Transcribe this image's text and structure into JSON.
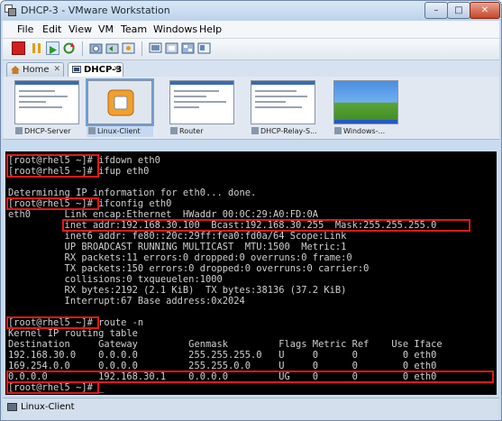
{
  "window": {
    "title": "DHCP-3 - VMware Workstation"
  },
  "menu": [
    "File",
    "Edit",
    "View",
    "VM",
    "Team",
    "Windows",
    "Help"
  ],
  "tabs": [
    {
      "label": "Home",
      "active": false
    },
    {
      "label": "DHCP-3",
      "active": true
    }
  ],
  "thumbnails": [
    {
      "label": "DHCP-Server",
      "selected": false
    },
    {
      "label": "Linux-Client",
      "selected": true
    },
    {
      "label": "Router",
      "selected": false
    },
    {
      "label": "DHCP-Relay-S...",
      "selected": false
    },
    {
      "label": "Windows-...",
      "selected": false
    }
  ],
  "console_lines": [
    "[root@rhel5 ~]# ifdown eth0",
    "[root@rhel5 ~]# ifup eth0",
    "",
    "Determining IP information for eth0... done.",
    "[root@rhel5 ~]# ifconfig eth0",
    "eth0      Link encap:Ethernet  HWaddr 00:0C:29:A0:FD:0A",
    "          inet addr:192.168.30.100  Bcast:192.168.30.255  Mask:255.255.255.0",
    "          inet6 addr: fe80::20c:29ff:fea0:fd0a/64 Scope:Link",
    "          UP BROADCAST RUNNING MULTICAST  MTU:1500  Metric:1",
    "          RX packets:11 errors:0 dropped:0 overruns:0 frame:0",
    "          TX packets:150 errors:0 dropped:0 overruns:0 carrier:0",
    "          collisions:0 txqueuelen:1000",
    "          RX bytes:2192 (2.1 KiB)  TX bytes:38136 (37.2 KiB)",
    "          Interrupt:67 Base address:0x2024",
    "",
    "[root@rhel5 ~]# route -n",
    "Kernel IP routing table",
    "Destination     Gateway         Genmask         Flags Metric Ref    Use Iface",
    "192.168.30.0    0.0.0.0         255.255.255.0   U     0      0        0 eth0",
    "169.254.0.0     0.0.0.0         255.255.0.0     U     0      0        0 eth0",
    "0.0.0.0         192.168.30.1    0.0.0.0         UG    0      0        0 eth0",
    "[root@rhel5 ~]# _"
  ],
  "status": {
    "label": "Linux-Client"
  },
  "colors": {
    "highlight": "#e01818",
    "console_bg": "#000000",
    "console_fg": "#d0d0d0"
  }
}
